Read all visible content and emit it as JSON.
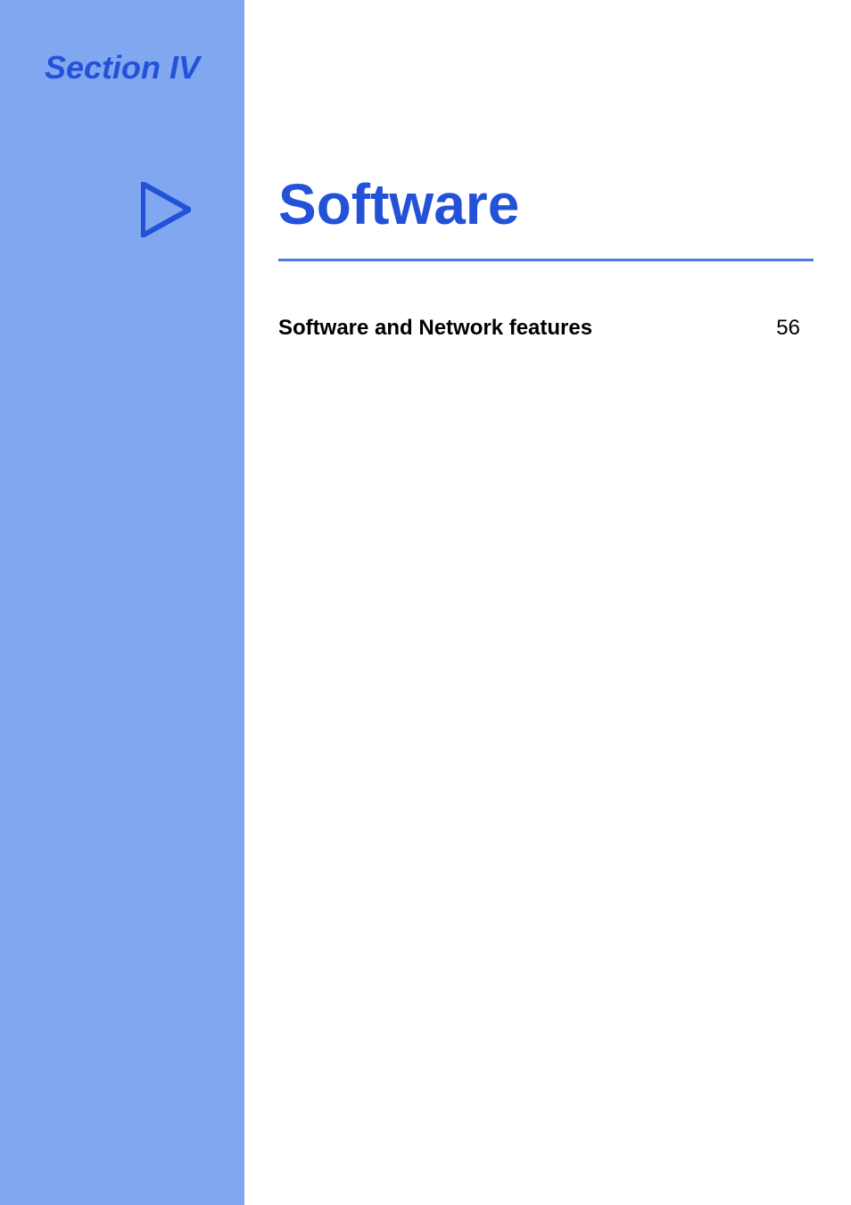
{
  "section_label": "Section IV",
  "title": "Software",
  "toc": {
    "items": [
      {
        "label": "Software and Network features",
        "page": "56"
      }
    ]
  }
}
